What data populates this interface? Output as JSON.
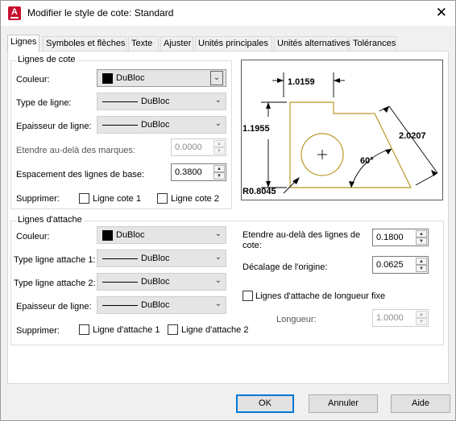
{
  "window": {
    "title": "Modifier le style de cote: Standard",
    "app_icon_letter": "A"
  },
  "tabs": [
    {
      "label": "Lignes",
      "active": true
    },
    {
      "label": "Symboles et flèches"
    },
    {
      "label": "Texte"
    },
    {
      "label": "Ajuster"
    },
    {
      "label": "Unités principales"
    },
    {
      "label": "Unités alternatives"
    },
    {
      "label": "Tolérances"
    }
  ],
  "dim_lines": {
    "group_title": "Lignes de cote",
    "color": {
      "label": "Couleur:",
      "value": "DuBloc"
    },
    "linetype": {
      "label": "Type de ligne:",
      "value": "DuBloc"
    },
    "lineweight": {
      "label": "Epaisseur de ligne:",
      "value": "DuBloc"
    },
    "extend": {
      "label": "Etendre au-delà des marques:",
      "value": "0.0000"
    },
    "spacing": {
      "label": "Espacement des lignes de base:",
      "value": "0.3800"
    },
    "suppress": {
      "label": "Supprimer:",
      "line1": "Ligne cote 1",
      "line2": "Ligne cote 2"
    }
  },
  "ext_lines": {
    "group_title": "Lignes d'attache",
    "color": {
      "label": "Couleur:",
      "value": "DuBloc"
    },
    "linetype1": {
      "label": "Type ligne attache 1:",
      "value": "DuBloc"
    },
    "linetype2": {
      "label": "Type ligne attache 2:",
      "value": "DuBloc"
    },
    "lineweight": {
      "label": "Epaisseur de ligne:",
      "value": "DuBloc"
    },
    "suppress": {
      "label": "Supprimer:",
      "line1": "Ligne d'attache 1",
      "line2": "Ligne d'attache 2"
    },
    "extend": {
      "label": "Etendre au-delà des lignes de cote:",
      "value": "0.1800"
    },
    "offset": {
      "label": "Décalage de l'origine:",
      "value": "0.0625"
    },
    "fixed_length": {
      "label": "Lignes d'attache de longueur fixe"
    },
    "length": {
      "label": "Longueur:",
      "value": "1.0000"
    }
  },
  "preview": {
    "dim_top": "1.0159",
    "dim_left": "1.1955",
    "dim_right": "2.0207",
    "dim_angle": "60°",
    "dim_radius": "R0.8045"
  },
  "buttons": {
    "ok": "OK",
    "cancel": "Annuler",
    "help": "Aide"
  },
  "colors": {
    "preview_outline": "#b89a26",
    "default_button_border": "#0078d7"
  },
  "icons": {
    "app": "autocad-app-icon",
    "close": "close-icon",
    "dropdown": "chevron-down-icon"
  }
}
